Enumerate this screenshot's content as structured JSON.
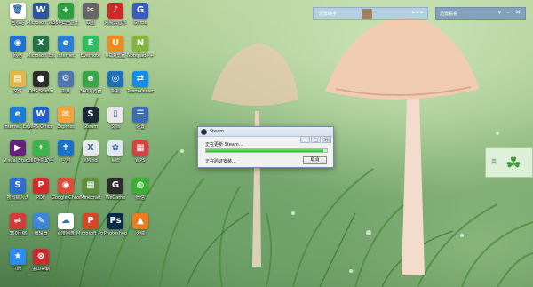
{
  "topbar": {
    "left_label": "迅雷助手",
    "right_label": "迅雷看看",
    "right_buttons": "▾ – ✕",
    "left_dots": "•••"
  },
  "dialog": {
    "title": "Steam",
    "line1": "正在更新 Steam...",
    "line2": "正在验证安装...",
    "cancel_label": "取消",
    "progress": 0.97,
    "buttons": [
      "–",
      "□",
      "✕"
    ]
  },
  "clover": {
    "label": "英",
    "leaf": "☘"
  },
  "desktop_icons": [
    {
      "label": "回收站",
      "color": "#ffffff",
      "glyph": "🗑",
      "name": "recycle-bin-icon"
    },
    {
      "label": "Microsoft Word",
      "color": "#2b579a",
      "glyph": "W",
      "name": "word-icon"
    },
    {
      "label": "360安全卫士",
      "color": "#2e9e3f",
      "glyph": "+",
      "name": "360-icon"
    },
    {
      "label": "截图",
      "color": "#666666",
      "glyph": "✂",
      "name": "capture-icon"
    },
    {
      "label": "网易云音乐",
      "color": "#cc2a28",
      "glyph": "♪",
      "name": "music-icon"
    },
    {
      "label": "Game",
      "color": "#3a5bbf",
      "glyph": "G",
      "name": "game-icon"
    },
    {
      "label": "网络",
      "color": "#1e6fd0",
      "glyph": "◉",
      "name": "network-icon"
    },
    {
      "label": "Microsoft Excel",
      "color": "#217346",
      "glyph": "X",
      "name": "excel-icon"
    },
    {
      "label": "Internet",
      "color": "#2a7fd4",
      "glyph": "e",
      "name": "ie-icon"
    },
    {
      "label": "Evernote",
      "color": "#2dbe60",
      "glyph": "E",
      "name": "evernote-icon"
    },
    {
      "label": "UC浏览器",
      "color": "#f08a1c",
      "glyph": "U",
      "name": "uc-icon"
    },
    {
      "label": "Notepad++",
      "color": "#84b53a",
      "glyph": "N",
      "name": "notepad-icon"
    },
    {
      "label": "文件",
      "color": "#e0b84a",
      "glyph": "▤",
      "name": "folder-icon"
    },
    {
      "label": "OBS Studio",
      "color": "#2b2b2b",
      "glyph": "●",
      "name": "obs-icon"
    },
    {
      "label": "工具",
      "color": "#4e74b2",
      "glyph": "⚙",
      "name": "tool-icon"
    },
    {
      "label": "360浏览器",
      "color": "#37a84a",
      "glyph": "e",
      "name": "360browser-icon"
    },
    {
      "label": "相机",
      "color": "#1c6fb8",
      "glyph": "◎",
      "name": "camera-icon"
    },
    {
      "label": "TeamViewer",
      "color": "#0e8ee9",
      "glyph": "⇄",
      "name": "teamviewer-icon"
    },
    {
      "label": "Internet Explorer",
      "color": "#1f7ad4",
      "glyph": "e",
      "name": "explorer-icon"
    },
    {
      "label": "WPS Office",
      "color": "#1f5fcf",
      "glyph": "W",
      "name": "wps-icon"
    },
    {
      "label": "Express",
      "color": "#f2a33b",
      "glyph": "✉",
      "name": "express-icon"
    },
    {
      "label": "Steam",
      "color": "#1b2838",
      "glyph": "S",
      "name": "steam-icon"
    },
    {
      "label": "文档",
      "color": "#e8e8e8",
      "glyph": "▯",
      "name": "doc-icon"
    },
    {
      "label": "设置",
      "color": "#3b6bb0",
      "glyph": "☰",
      "name": "settings-icon"
    },
    {
      "label": "Visual Studio",
      "color": "#68217a",
      "glyph": "▶",
      "name": "vs-icon"
    },
    {
      "label": "360手机助手",
      "color": "#3cb44a",
      "glyph": "✦",
      "name": "phone-icon"
    },
    {
      "label": "应用",
      "color": "#1a72c7",
      "glyph": "✝",
      "name": "app-icon"
    },
    {
      "label": "XMind",
      "color": "#e8e8e8",
      "glyph": "X",
      "name": "xmind-icon"
    },
    {
      "label": "系统",
      "color": "#dfe7ef",
      "glyph": "✿",
      "name": "system-icon"
    },
    {
      "label": "WPS",
      "color": "#d94040",
      "glyph": "▦",
      "name": "wps-app-icon"
    },
    {
      "label": "搜狗输入法",
      "color": "#2b6dd1",
      "glyph": "S",
      "name": "sogou-icon"
    },
    {
      "label": "PDF",
      "color": "#d42a2a",
      "glyph": "P",
      "name": "pdf-icon"
    },
    {
      "label": "Google Chrome",
      "color": "#dd4b39",
      "glyph": "◉",
      "name": "chrome-icon"
    },
    {
      "label": "Minecraft",
      "color": "#5f8d3a",
      "glyph": "▦",
      "name": "minecraft-icon"
    },
    {
      "label": "WeGame",
      "color": "#2b2b2b",
      "glyph": "G",
      "name": "wegame-icon"
    },
    {
      "label": "微信",
      "color": "#3cb034",
      "glyph": "◍",
      "name": "wechat-icon"
    },
    {
      "label": "360压缩",
      "color": "#d33a3a",
      "glyph": "⇌",
      "name": "zip-icon"
    },
    {
      "label": "编辑器",
      "color": "#3e86d9",
      "glyph": "✎",
      "name": "editor-icon"
    },
    {
      "label": "百度网盘",
      "color": "#ffffff",
      "glyph": "☁",
      "name": "cloud-icon"
    },
    {
      "label": "Microsoft PowerPoint",
      "color": "#d24726",
      "glyph": "P",
      "name": "powerpoint-icon"
    },
    {
      "label": "Photoshop",
      "color": "#0a2a4a",
      "glyph": "Ps",
      "name": "photoshop-icon"
    },
    {
      "label": "火绒",
      "color": "#f07a1e",
      "glyph": "▲",
      "name": "huorong-icon"
    },
    {
      "label": "TIM",
      "color": "#2d8cf0",
      "glyph": "★",
      "name": "tim-icon"
    },
    {
      "label": "金山毒霸",
      "color": "#c62d2d",
      "glyph": "⊗",
      "name": "antivirus-icon"
    }
  ]
}
